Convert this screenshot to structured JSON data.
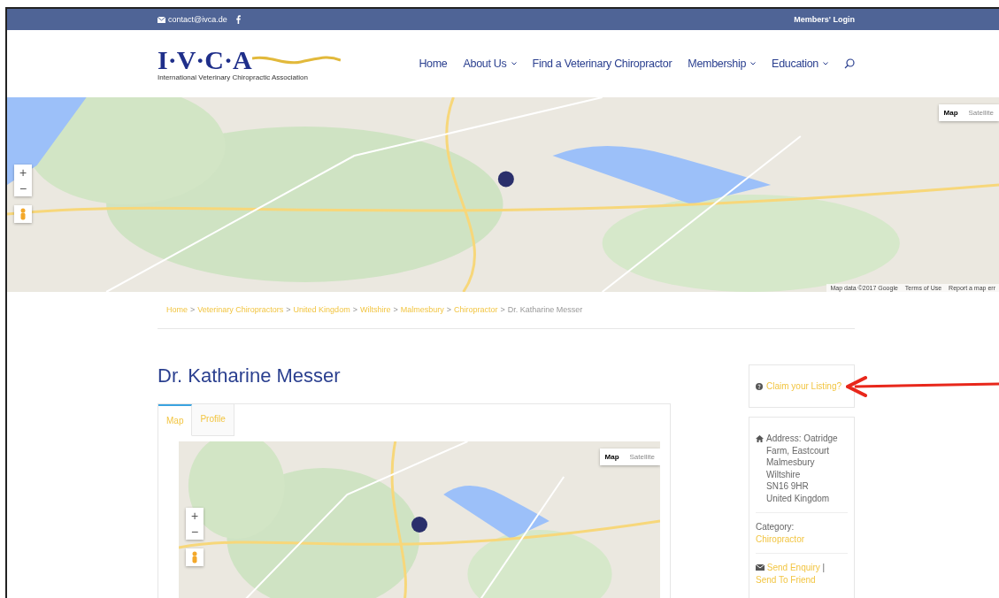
{
  "top_bar": {
    "email": "contact@ivca.de",
    "login": "Members' Login"
  },
  "logo": {
    "letters": "I·V·C·A",
    "subtitle": "International Veterinary Chiropractic Association"
  },
  "nav": [
    {
      "label": "Home",
      "has_dropdown": false
    },
    {
      "label": "About Us",
      "has_dropdown": true
    },
    {
      "label": "Find a Veterinary Chiropractor",
      "has_dropdown": false
    },
    {
      "label": "Membership",
      "has_dropdown": true
    },
    {
      "label": "Education",
      "has_dropdown": true
    }
  ],
  "banner_map": {
    "zoom_in": "+",
    "zoom_out": "−",
    "map_type_buttons": [
      {
        "label": "Map",
        "selected": true
      },
      {
        "label": "Satellite",
        "selected": false
      }
    ],
    "attribution": [
      "Map data ©2017 Google",
      "Terms of Use",
      "Report a map err"
    ]
  },
  "breadcrumb": {
    "separator": ">",
    "items": [
      {
        "label": "Home",
        "link": true
      },
      {
        "label": "Veterinary Chiropractors",
        "link": true
      },
      {
        "label": "United Kingdom",
        "link": true
      },
      {
        "label": "Wiltshire",
        "link": true
      },
      {
        "label": "Malmesbury",
        "link": true
      },
      {
        "label": "Chiropractor",
        "link": true
      },
      {
        "label": "Dr. Katharine Messer",
        "link": false
      }
    ]
  },
  "listing": {
    "title": "Dr. Katharine Messer",
    "tabs": [
      {
        "label": "Map",
        "selected": true
      },
      {
        "label": "Profile",
        "selected": false
      }
    ],
    "map": {
      "zoom_in": "+",
      "zoom_out": "−",
      "map_type_buttons": [
        {
          "label": "Map",
          "selected": true
        },
        {
          "label": "Satellite",
          "selected": false
        }
      ]
    }
  },
  "sidebar": {
    "claim_link": "Claim your Listing?",
    "address_lines": [
      "Address: Oatridge Farm, Eastcourt",
      "Malmesbury",
      "Wiltshire",
      "SN16 9HR",
      "United Kingdom"
    ],
    "category_label": "Category:",
    "category": "Chiropractor",
    "contact_links": [
      "Send Enquiry",
      "Send To Friend"
    ],
    "contact_separator": "|"
  }
}
